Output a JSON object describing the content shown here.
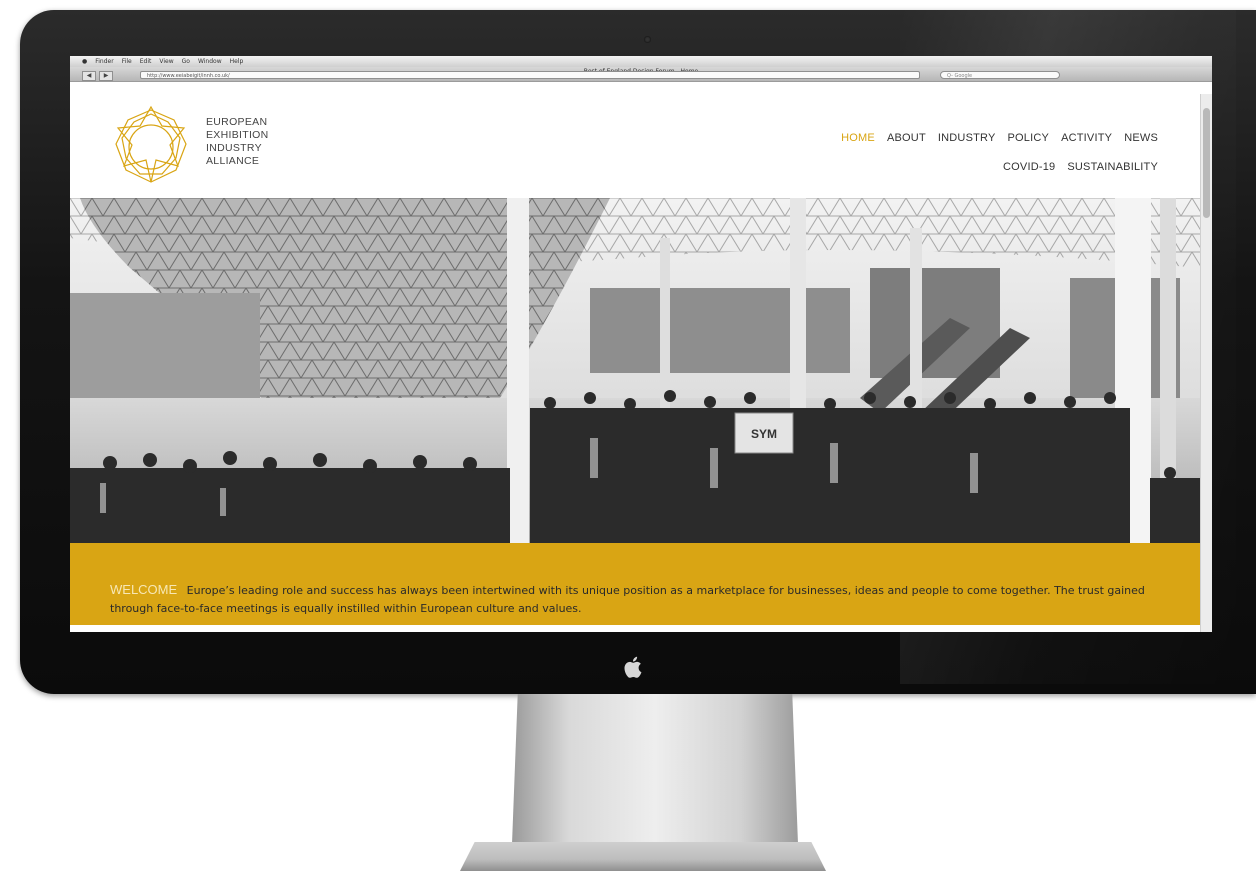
{
  "browser": {
    "menu_items": [
      "Finder",
      "File",
      "Edit",
      "View",
      "Go",
      "Window",
      "Help"
    ],
    "window_title": "Best of England Design Forum - Home",
    "back_label": "◀",
    "forward_label": "▶",
    "address": "http://www.eeiabeigit/innh.co.uk/",
    "search_placeholder": "Q- Google"
  },
  "site": {
    "logo_lines": [
      "EUROPEAN",
      "EXHIBITION",
      "INDUSTRY",
      "ALLIANCE"
    ],
    "nav_row1": [
      "HOME",
      "ABOUT",
      "INDUSTRY",
      "POLICY",
      "ACTIVITY",
      "NEWS"
    ],
    "nav_row2": [
      "COVID-19",
      "SUSTAINABILITY"
    ],
    "active_nav": "HOME",
    "hero_sign": "SYM",
    "welcome_label": "WELCOME",
    "welcome_text": "Europe’s leading role and success has always been intertwined with its unique position as a marketplace for businesses, ideas and people to come together. The trust gained through face-to-face meetings is equally instilled within European culture and values."
  },
  "colors": {
    "accent": "#d9a514",
    "bezel": "#141414",
    "nav_text": "#333333"
  },
  "icons": {
    "logo": "geometric-star-ring",
    "hardware": "apple-logo"
  }
}
